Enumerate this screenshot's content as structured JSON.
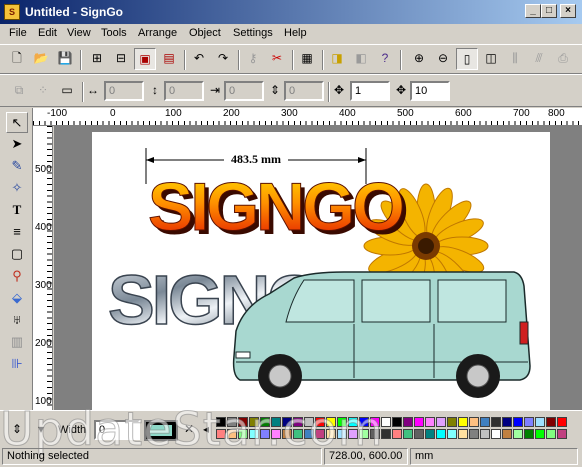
{
  "window": {
    "title": "Untitled - SignGo",
    "app_icon": "signgo-app-icon"
  },
  "menu": [
    "File",
    "Edit",
    "View",
    "Tools",
    "Arrange",
    "Object",
    "Settings",
    "Help"
  ],
  "toolbar2": {
    "x_value": "0",
    "y_value": "0",
    "w_value": "0",
    "h_value": "0",
    "spin_x": "1",
    "spin_y": "10"
  },
  "ruler": {
    "h_ticks": [
      "-100",
      "0",
      "100",
      "200",
      "300",
      "400",
      "500",
      "600",
      "700",
      "800"
    ],
    "v_ticks": [
      "500",
      "400",
      "300",
      "200",
      "100"
    ]
  },
  "canvas": {
    "dimension_label": "483.5 mm",
    "text_top": "SIGNGO",
    "text_bottom": "SIGNGO"
  },
  "bottom": {
    "width_label": "Width",
    "width_value": "0"
  },
  "status": {
    "message": "Nothing selected",
    "coords": "728.00, 600.00",
    "unit": "mm"
  },
  "watermark": "UpdateStar.com",
  "colors": {
    "titlebar_start": "#0a246a",
    "palette": [
      "#000000",
      "#808080",
      "#800000",
      "#808000",
      "#008000",
      "#008080",
      "#000080",
      "#800080",
      "#c0c0c0",
      "#ff0000",
      "#ffff00",
      "#00ff00",
      "#00ffff",
      "#0000ff",
      "#ff00ff",
      "#ffffff",
      "#ff8080",
      "#ffc080",
      "#80ff80",
      "#80ffff",
      "#8080ff",
      "#ff80ff",
      "#c08040",
      "#40c080",
      "#4080c0",
      "#c04080",
      "#ffe0a0",
      "#a0e0ff",
      "#e0a0ff",
      "#a0ffa0",
      "#606060",
      "#303030"
    ]
  }
}
